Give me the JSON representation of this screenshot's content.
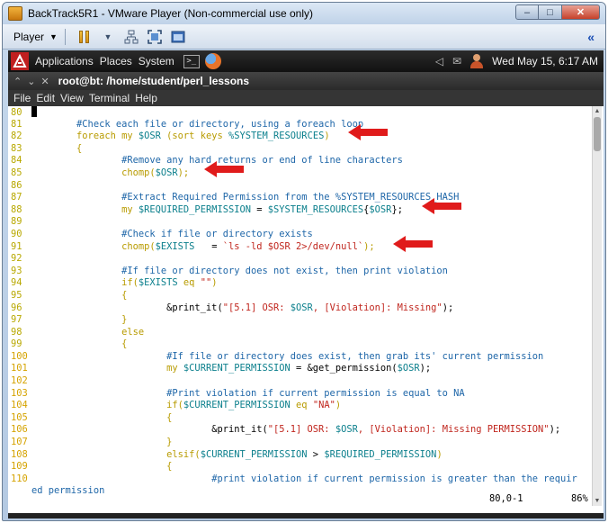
{
  "vmware": {
    "title": "BackTrack5R1 - VMware Player (Non-commercial use only)",
    "player_menu": "Player",
    "minimize": "–",
    "maximize": "□",
    "close": "✕",
    "collapse": "«"
  },
  "panel": {
    "applications": "Applications",
    "places": "Places",
    "system": "System",
    "term_icon": ">_",
    "clock": "Wed May 15,  6:17 AM"
  },
  "terminal": {
    "title": "root@bt: /home/student/perl_lessons",
    "menu": [
      "File",
      "Edit",
      "View",
      "Terminal",
      "Help"
    ],
    "status_position": "80,0-1",
    "status_percent": "86%"
  },
  "code_lines": [
    {
      "n": "80",
      "segs": [
        [
          "",
          ""
        ]
      ],
      "cursor": true
    },
    {
      "n": "81",
      "segs": [
        [
          "",
          "        "
        ],
        [
          "cm",
          "#Check each file or directory, using a foreach loop"
        ]
      ]
    },
    {
      "n": "82",
      "segs": [
        [
          "",
          "        "
        ],
        [
          "kw",
          "foreach my "
        ],
        [
          "vr",
          "$OSR"
        ],
        [
          "kw",
          " (sort keys "
        ],
        [
          "vr",
          "%SYSTEM_RESOURCES"
        ],
        [
          "kw",
          ")"
        ]
      ]
    },
    {
      "n": "83",
      "segs": [
        [
          "",
          "        "
        ],
        [
          "kw",
          "{"
        ]
      ]
    },
    {
      "n": "84",
      "segs": [
        [
          "",
          "                "
        ],
        [
          "cm",
          "#Remove any hard returns or end of line characters"
        ]
      ]
    },
    {
      "n": "85",
      "segs": [
        [
          "",
          "                "
        ],
        [
          "kw",
          "chomp("
        ],
        [
          "vr",
          "$OSR"
        ],
        [
          "kw",
          ");"
        ]
      ]
    },
    {
      "n": "86",
      "segs": [
        [
          "",
          ""
        ]
      ]
    },
    {
      "n": "87",
      "segs": [
        [
          "",
          "                "
        ],
        [
          "cm",
          "#Extract Required Permission from the %SYSTEM_RESOURCES_HASH"
        ]
      ]
    },
    {
      "n": "88",
      "segs": [
        [
          "",
          "                "
        ],
        [
          "kw",
          "my "
        ],
        [
          "vr",
          "$REQUIRED_PERMISSION"
        ],
        [
          "",
          " = "
        ],
        [
          "vr",
          "$SYSTEM_RESOURCES"
        ],
        [
          "",
          "{"
        ],
        [
          "vr",
          "$OSR"
        ],
        [
          "",
          "};"
        ]
      ]
    },
    {
      "n": "89",
      "segs": [
        [
          "",
          ""
        ]
      ]
    },
    {
      "n": "90",
      "segs": [
        [
          "",
          "                "
        ],
        [
          "cm",
          "#Check if file or directory exists"
        ]
      ]
    },
    {
      "n": "91",
      "segs": [
        [
          "",
          "                "
        ],
        [
          "kw",
          "chomp("
        ],
        [
          "vr",
          "$EXISTS"
        ],
        [
          "",
          "   = "
        ],
        [
          "st",
          "`ls -ld $OSR 2>/dev/null`"
        ],
        [
          "kw",
          ");"
        ]
      ]
    },
    {
      "n": "92",
      "segs": [
        [
          "",
          ""
        ]
      ]
    },
    {
      "n": "93",
      "segs": [
        [
          "",
          "                "
        ],
        [
          "cm",
          "#If file or directory does not exist, then print violation"
        ]
      ]
    },
    {
      "n": "94",
      "segs": [
        [
          "",
          "                "
        ],
        [
          "kw",
          "if("
        ],
        [
          "vr",
          "$EXISTS"
        ],
        [
          "kw",
          " eq "
        ],
        [
          "st",
          "\"\""
        ],
        [
          "kw",
          ")"
        ]
      ]
    },
    {
      "n": "95",
      "segs": [
        [
          "",
          "                "
        ],
        [
          "kw",
          "{"
        ]
      ]
    },
    {
      "n": "96",
      "segs": [
        [
          "",
          "                        "
        ],
        [
          "",
          "&print_it("
        ],
        [
          "st",
          "\"[5.1] OSR: "
        ],
        [
          "vr",
          "$OSR"
        ],
        [
          "st",
          ", [Violation]: Missing\""
        ],
        [
          "",
          ");"
        ]
      ]
    },
    {
      "n": "97",
      "segs": [
        [
          "",
          "                "
        ],
        [
          "kw",
          "}"
        ]
      ]
    },
    {
      "n": "98",
      "segs": [
        [
          "",
          "                "
        ],
        [
          "kw",
          "else"
        ]
      ]
    },
    {
      "n": "99",
      "segs": [
        [
          "",
          "                "
        ],
        [
          "kw",
          "{"
        ]
      ]
    },
    {
      "n": "100",
      "segs": [
        [
          "",
          "                        "
        ],
        [
          "cm",
          "#If file or directory does exist, then grab its' current permission"
        ]
      ]
    },
    {
      "n": "101",
      "segs": [
        [
          "",
          "                        "
        ],
        [
          "kw",
          "my "
        ],
        [
          "vr",
          "$CURRENT_PERMISSION"
        ],
        [
          "",
          " = &get_permission("
        ],
        [
          "vr",
          "$OSR"
        ],
        [
          "",
          ");"
        ]
      ]
    },
    {
      "n": "102",
      "segs": [
        [
          "",
          ""
        ]
      ]
    },
    {
      "n": "103",
      "segs": [
        [
          "",
          "                        "
        ],
        [
          "cm",
          "#Print violation if current permission is equal to NA"
        ]
      ]
    },
    {
      "n": "104",
      "segs": [
        [
          "",
          "                        "
        ],
        [
          "kw",
          "if("
        ],
        [
          "vr",
          "$CURRENT_PERMISSION"
        ],
        [
          "kw",
          " eq "
        ],
        [
          "st",
          "\"NA\""
        ],
        [
          "kw",
          ")"
        ]
      ]
    },
    {
      "n": "105",
      "segs": [
        [
          "",
          "                        "
        ],
        [
          "kw",
          "{"
        ]
      ]
    },
    {
      "n": "106",
      "segs": [
        [
          "",
          "                                "
        ],
        [
          "",
          "&print_it("
        ],
        [
          "st",
          "\"[5.1] OSR: "
        ],
        [
          "vr",
          "$OSR"
        ],
        [
          "st",
          ", [Violation]: Missing PERMISSION\""
        ],
        [
          "",
          ");"
        ]
      ]
    },
    {
      "n": "107",
      "segs": [
        [
          "",
          "                        "
        ],
        [
          "kw",
          "}"
        ]
      ]
    },
    {
      "n": "108",
      "segs": [
        [
          "",
          "                        "
        ],
        [
          "kw",
          "elsif("
        ],
        [
          "vr",
          "$CURRENT_PERMISSION"
        ],
        [
          "",
          " > "
        ],
        [
          "vr",
          "$REQUIRED_PERMISSION"
        ],
        [
          "kw",
          ")"
        ]
      ]
    },
    {
      "n": "109",
      "segs": [
        [
          "",
          "                        "
        ],
        [
          "kw",
          "{"
        ]
      ]
    },
    {
      "n": "110",
      "segs": [
        [
          "",
          "                                "
        ],
        [
          "cm",
          "#print violation if current permission is greater than the requir"
        ]
      ]
    },
    {
      "n": "",
      "segs": [
        [
          "cm",
          "ed permission"
        ]
      ]
    }
  ],
  "annotation_color": "#e01b1b"
}
